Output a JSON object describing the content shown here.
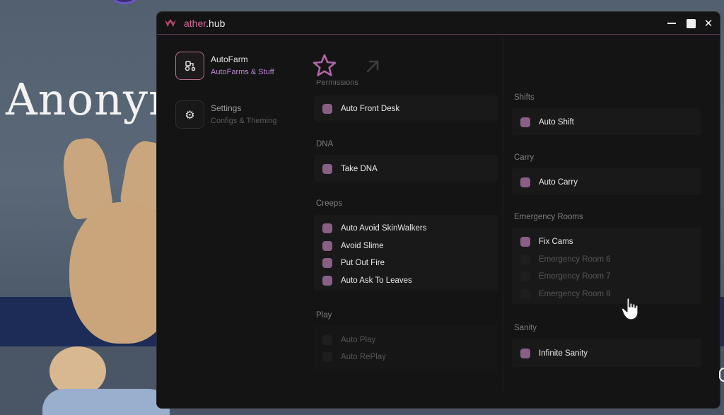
{
  "background": {
    "player_name": "Anonyn"
  },
  "window": {
    "brand_prefix": "ather",
    "brand_suffix": ".hub",
    "accent_color": "#d46a97",
    "toggle_on_color": "#8a5f86"
  },
  "sidebar": {
    "items": [
      {
        "title": "AutoFarm",
        "subtitle": "AutoFarms & Stuff",
        "icon": "tractor-icon",
        "active": true
      },
      {
        "title": "Settings",
        "subtitle": "Configs & Theming",
        "icon": "gear-icon",
        "active": false
      }
    ]
  },
  "tabs": {
    "favorite_icon": "star-icon",
    "popout_icon": "arrow-up-right-icon"
  },
  "left_column": {
    "cutoff_label": "Permissions",
    "permissions": {
      "items": [
        {
          "label": "Auto Front Desk",
          "on": true
        }
      ]
    },
    "dna": {
      "title": "DNA",
      "items": [
        {
          "label": "Take DNA",
          "on": true
        }
      ]
    },
    "creeps": {
      "title": "Creeps",
      "items": [
        {
          "label": "Auto Avoid SkinWalkers",
          "on": true
        },
        {
          "label": "Avoid Slime",
          "on": true
        },
        {
          "label": "Put Out Fire",
          "on": true
        },
        {
          "label": "Auto Ask To Leaves",
          "on": true
        }
      ]
    },
    "play": {
      "title": "Play",
      "items": [
        {
          "label": "Auto Play",
          "on": false
        },
        {
          "label": "Auto RePlay",
          "on": false
        }
      ]
    }
  },
  "right_column": {
    "shifts": {
      "title": "Shifts",
      "items": [
        {
          "label": "Auto Shift",
          "on": true
        }
      ]
    },
    "carry": {
      "title": "Carry",
      "items": [
        {
          "label": "Auto Carry",
          "on": true
        }
      ]
    },
    "emergency": {
      "title": "Emergency Rooms",
      "items": [
        {
          "label": "Fix Cams",
          "on": true
        },
        {
          "label": "Emergency Room 6",
          "on": false
        },
        {
          "label": "Emergency Room 7",
          "on": false
        },
        {
          "label": "Emergency Room 8",
          "on": false
        }
      ]
    },
    "sanity": {
      "title": "Sanity",
      "items": [
        {
          "label": "Infinite Sanity",
          "on": true
        }
      ]
    }
  }
}
